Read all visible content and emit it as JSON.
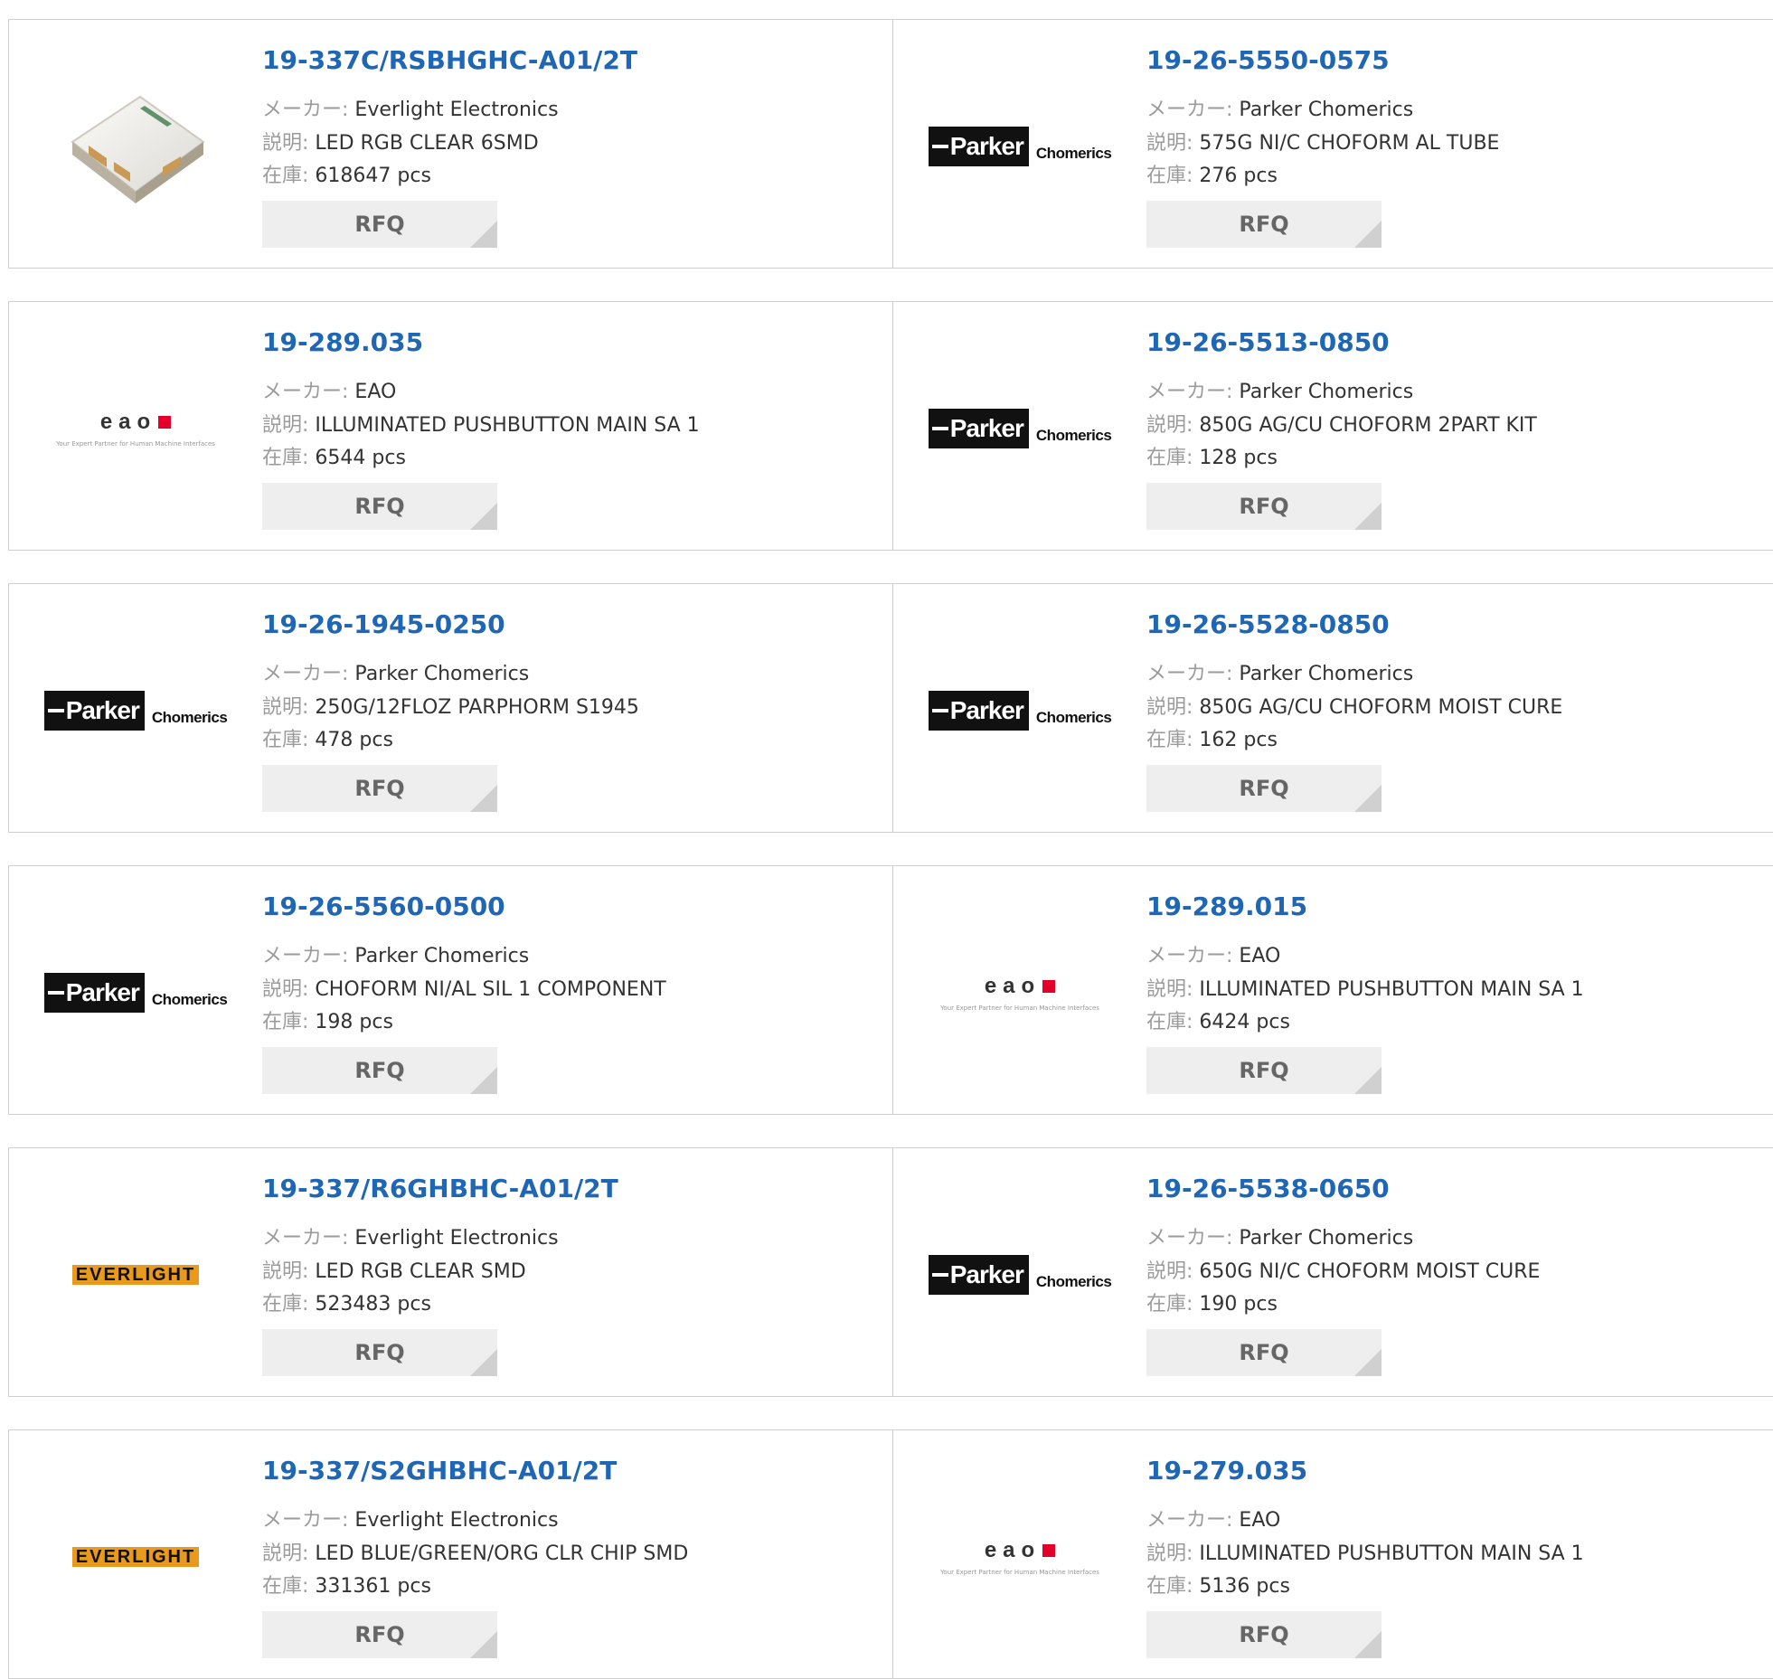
{
  "labels": {
    "maker": "メーカー:",
    "desc": "説明:",
    "stock": "在庫:",
    "rfq": "RFQ"
  },
  "logos": {
    "parker": {
      "main": "Parker",
      "sub": "Chomerics"
    },
    "eao": {
      "main": "eao",
      "tagline": "Your Expert Partner for Human Machine Interfaces"
    },
    "everlight": {
      "main": "EVERLIGHT"
    }
  },
  "colors": {
    "link": "#1f66b5",
    "label": "#9b9b9b",
    "rfq_bg": "#eeeeee",
    "eao_red": "#e4002b",
    "everlight_orange": "#e79a1e"
  },
  "products": [
    {
      "part": "19-337C/RSBHGHC-A01/2T",
      "maker": "Everlight Electronics",
      "desc": "LED RGB CLEAR 6SMD",
      "stock": "618647 pcs",
      "logo": "led-photo"
    },
    {
      "part": "19-26-5550-0575",
      "maker": "Parker Chomerics",
      "desc": "575G NI/C CHOFORM AL TUBE",
      "stock": "276 pcs",
      "logo": "parker"
    },
    {
      "part": "19-289.035",
      "maker": "EAO",
      "desc": "ILLUMINATED PUSHBUTTON MAIN SA 1",
      "stock": "6544 pcs",
      "logo": "eao"
    },
    {
      "part": "19-26-5513-0850",
      "maker": "Parker Chomerics",
      "desc": "850G AG/CU CHOFORM 2PART KIT",
      "stock": "128 pcs",
      "logo": "parker"
    },
    {
      "part": "19-26-1945-0250",
      "maker": "Parker Chomerics",
      "desc": "250G/12FLOZ PARPHORM S1945",
      "stock": "478 pcs",
      "logo": "parker"
    },
    {
      "part": "19-26-5528-0850",
      "maker": "Parker Chomerics",
      "desc": "850G AG/CU CHOFORM MOIST CURE",
      "stock": "162 pcs",
      "logo": "parker"
    },
    {
      "part": "19-26-5560-0500",
      "maker": "Parker Chomerics",
      "desc": "CHOFORM NI/AL SIL 1 COMPONENT",
      "stock": "198 pcs",
      "logo": "parker"
    },
    {
      "part": "19-289.015",
      "maker": "EAO",
      "desc": "ILLUMINATED PUSHBUTTON MAIN SA 1",
      "stock": "6424 pcs",
      "logo": "eao"
    },
    {
      "part": "19-337/R6GHBHC-A01/2T",
      "maker": "Everlight Electronics",
      "desc": "LED RGB CLEAR SMD",
      "stock": "523483 pcs",
      "logo": "everlight"
    },
    {
      "part": "19-26-5538-0650",
      "maker": "Parker Chomerics",
      "desc": "650G NI/C CHOFORM MOIST CURE",
      "stock": "190 pcs",
      "logo": "parker"
    },
    {
      "part": "19-337/S2GHBHC-A01/2T",
      "maker": "Everlight Electronics",
      "desc": "LED BLUE/GREEN/ORG CLR CHIP SMD",
      "stock": "331361 pcs",
      "logo": "everlight"
    },
    {
      "part": "19-279.035",
      "maker": "EAO",
      "desc": "ILLUMINATED PUSHBUTTON MAIN SA 1",
      "stock": "5136 pcs",
      "logo": "eao"
    }
  ]
}
